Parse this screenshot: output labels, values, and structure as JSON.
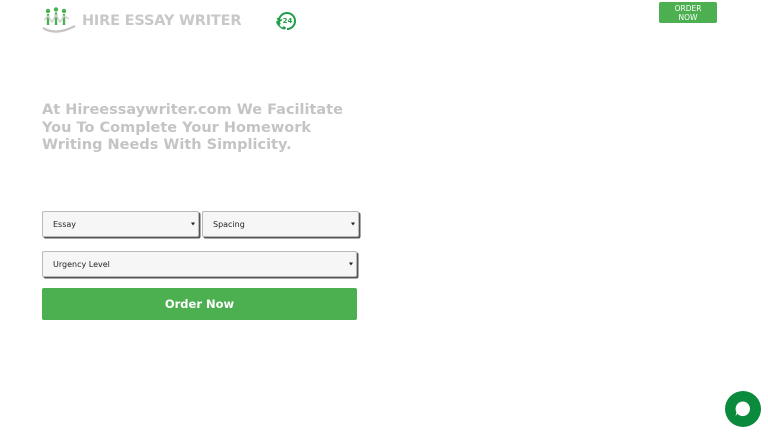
{
  "header": {
    "brand_name": "HIRE ESSAY WRITER",
    "support_badge": "24",
    "order_button_label": "ORDER NOW"
  },
  "hero": {
    "headline": "At Hireessaywriter.com We Facilitate You To Complete Your Homework Writing Needs With Simplicity."
  },
  "order_form": {
    "paper_type": {
      "selected": "Essay"
    },
    "spacing": {
      "selected": "Spacing"
    },
    "urgency": {
      "selected": "Urgency Level"
    },
    "submit_label": "Order Now"
  },
  "icons": {
    "logo": "people-icon",
    "support": "phone-24-icon",
    "chat": "chat-bubble-icon"
  },
  "colors": {
    "brand_green": "#4caf50",
    "chat_green": "#0a8a3c",
    "muted_text": "#c4c4c4"
  }
}
